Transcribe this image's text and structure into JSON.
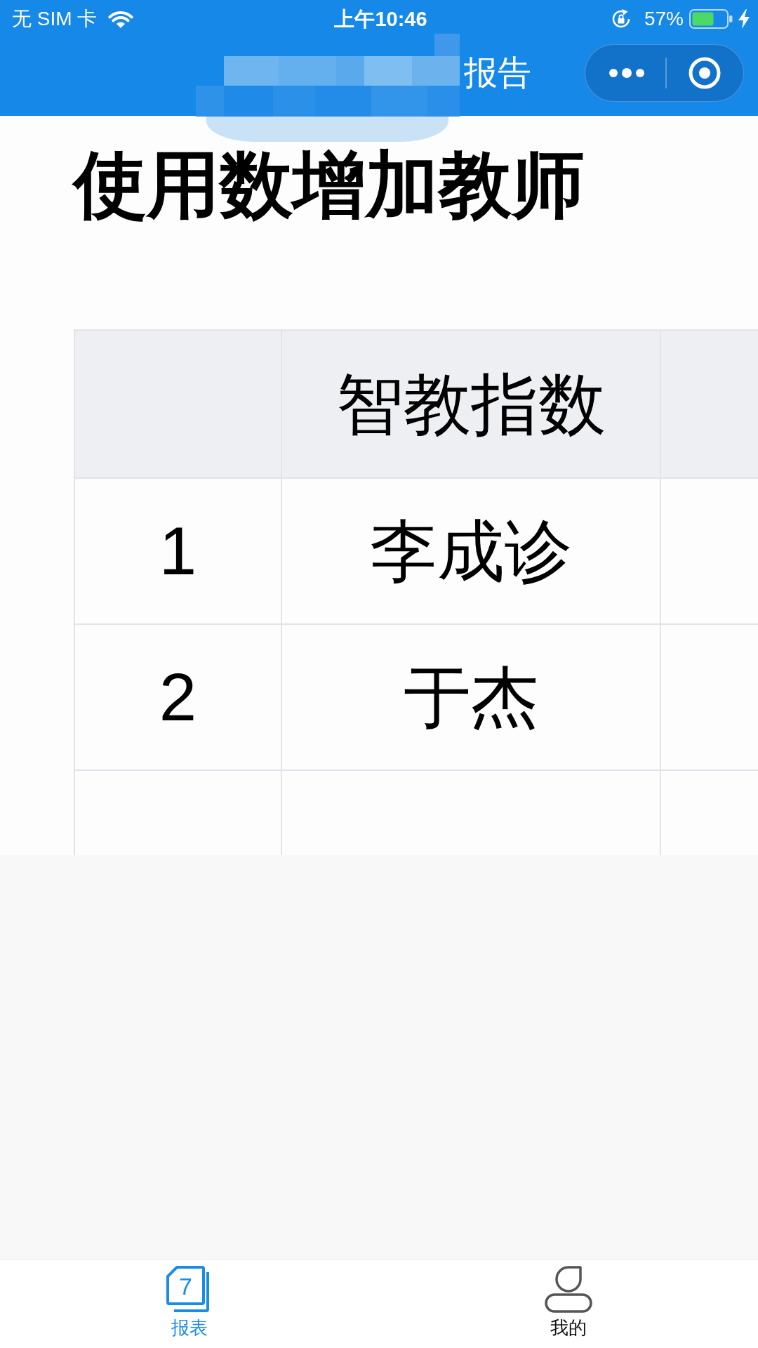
{
  "status_bar": {
    "carrier": "无 SIM 卡",
    "time": "上午10:46",
    "battery": "57%"
  },
  "nav_bar": {
    "title": "报告"
  },
  "heading": "使用数增加教师",
  "table": {
    "header": {
      "column_2": "智教指数"
    },
    "rows": [
      {
        "column_1": "1",
        "column_2": "李成诊"
      },
      {
        "column_1": "2",
        "column_2": "于杰"
      }
    ]
  },
  "tab_bar": [
    {
      "label": "报表",
      "icon_text": "7",
      "selected": true
    },
    {
      "label": "我的",
      "selected": false
    }
  ]
}
